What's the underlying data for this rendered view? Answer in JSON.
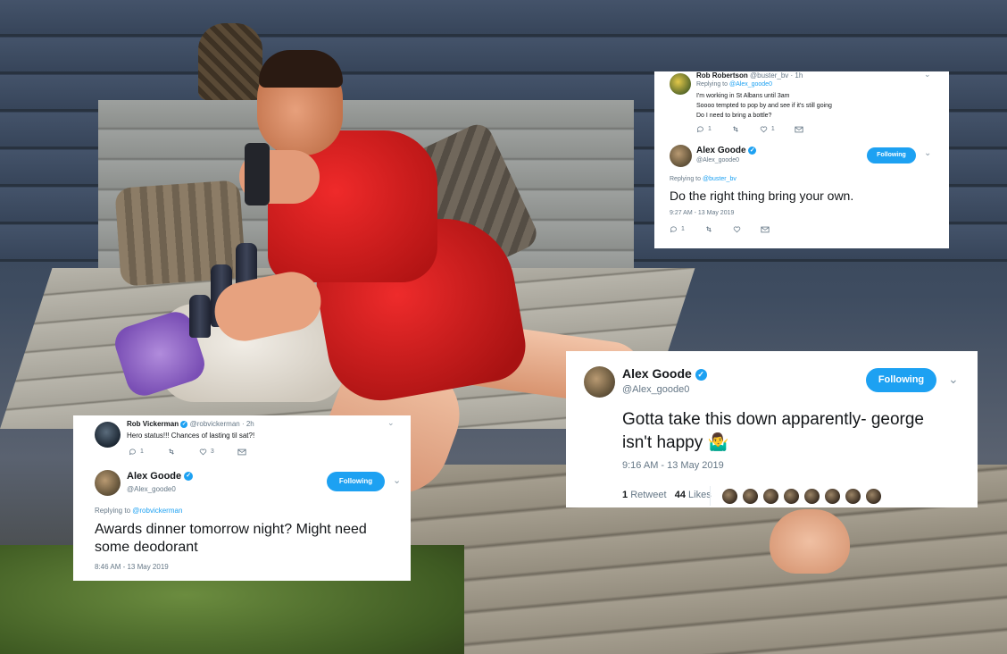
{
  "card_a": {
    "reply": {
      "name": "Rob Robertson",
      "handle": "@buster_bv",
      "time": "· 1h",
      "replying_label": "Replying to",
      "replying_to": "@Alex_goode0",
      "lines": [
        "I'm working in St Albans until 3am",
        "Soooo tempted to pop by and see if it's still going",
        "Do I need to bring a bottle?"
      ],
      "replies": "1",
      "likes": "1"
    },
    "main": {
      "name": "Alex Goode",
      "handle": "@Alex_goode0",
      "follow_label": "Following",
      "replying_label": "Replying to",
      "replying_to": "@buster_bv",
      "text": "Do the right thing bring your own.",
      "timestamp": "9:27 AM - 13 May 2019",
      "replies": "1"
    }
  },
  "card_b": {
    "reply": {
      "name": "Rob Vickerman",
      "handle": "@robvickerman",
      "time": "· 2h",
      "text": "Hero status!!! Chances of lasting til sat?!",
      "replies": "1",
      "likes": "3"
    },
    "main": {
      "name": "Alex Goode",
      "handle": "@Alex_goode0",
      "follow_label": "Following",
      "replying_label": "Replying to",
      "replying_to": "@robvickerman",
      "text_line1": "Awards dinner tomorrow night? Might need",
      "text_line2": "some deodorant",
      "timestamp": "8:46 AM - 13 May 2019"
    }
  },
  "card_c": {
    "name": "Alex Goode",
    "handle": "@Alex_goode0",
    "follow_label": "Following",
    "text_line1": "Gotta take this down apparently- george",
    "text_line2": "isn't happy",
    "emoji": "🤷‍♂️",
    "timestamp": "9:16 AM - 13 May 2019",
    "retweets": "1",
    "retweets_label": "Retweet",
    "likes": "44",
    "likes_label": "Likes"
  },
  "icons": [
    "reply-icon",
    "retweet-icon",
    "like-icon",
    "message-icon",
    "verified-icon",
    "chevron-down-icon"
  ],
  "colors": {
    "accent": "#1da1f2",
    "muted": "#657786"
  }
}
